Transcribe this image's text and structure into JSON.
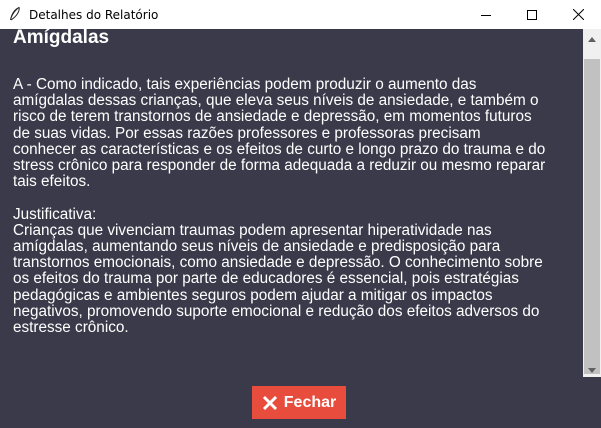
{
  "window": {
    "title": "Detalhes do Relatório",
    "icon": "feather-icon",
    "controls": [
      "minimize-icon",
      "maximize-icon",
      "close-icon"
    ]
  },
  "report": {
    "heading": "Amígdalas",
    "paragraph": "A - Como indicado, tais experiências podem produzir o aumento das\namígdalas dessas crianças, que eleva seus níveis de ansiedade, e também o\nrisco de terem transtornos de ansiedade e depressão, em momentos futuros\nde suas vidas. Por essas razões professores e professoras precisam\nconhecer as características e os efeitos de curto e longo prazo do trauma e do\nstress crônico para responder de forma adequada a reduzir ou mesmo reparar\ntais efeitos.\n\nJustificativa:\nCrianças que vivenciam traumas podem apresentar hiperatividade nas\namígdalas, aumentando seus níveis de ansiedade e predisposição para\ntranstornos emocionais, como ansiedade e depressão. O conhecimento sobre\nos efeitos do trauma por parte de educadores é essencial, pois estratégias\npedagógicas e ambientes seguros podem ajudar a mitigar os impactos\nnegativos, promovendo suporte emocional e redução dos efeitos adversos do\nestresse crônico."
  },
  "footer": {
    "close_label": "Fechar",
    "close_icon": "x-icon"
  },
  "colors": {
    "background": "#3a3a4a",
    "text": "#ffffff",
    "button": "#e74c3c"
  }
}
